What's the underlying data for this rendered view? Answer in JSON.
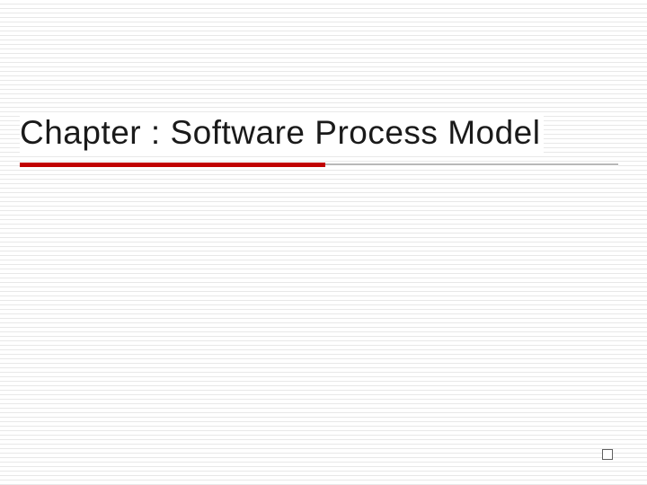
{
  "slide": {
    "title": "Chapter : Software Process Model"
  },
  "theme": {
    "accent_color": "#c00000",
    "line_color": "#e8e8e8",
    "marker_color": "#606060"
  }
}
